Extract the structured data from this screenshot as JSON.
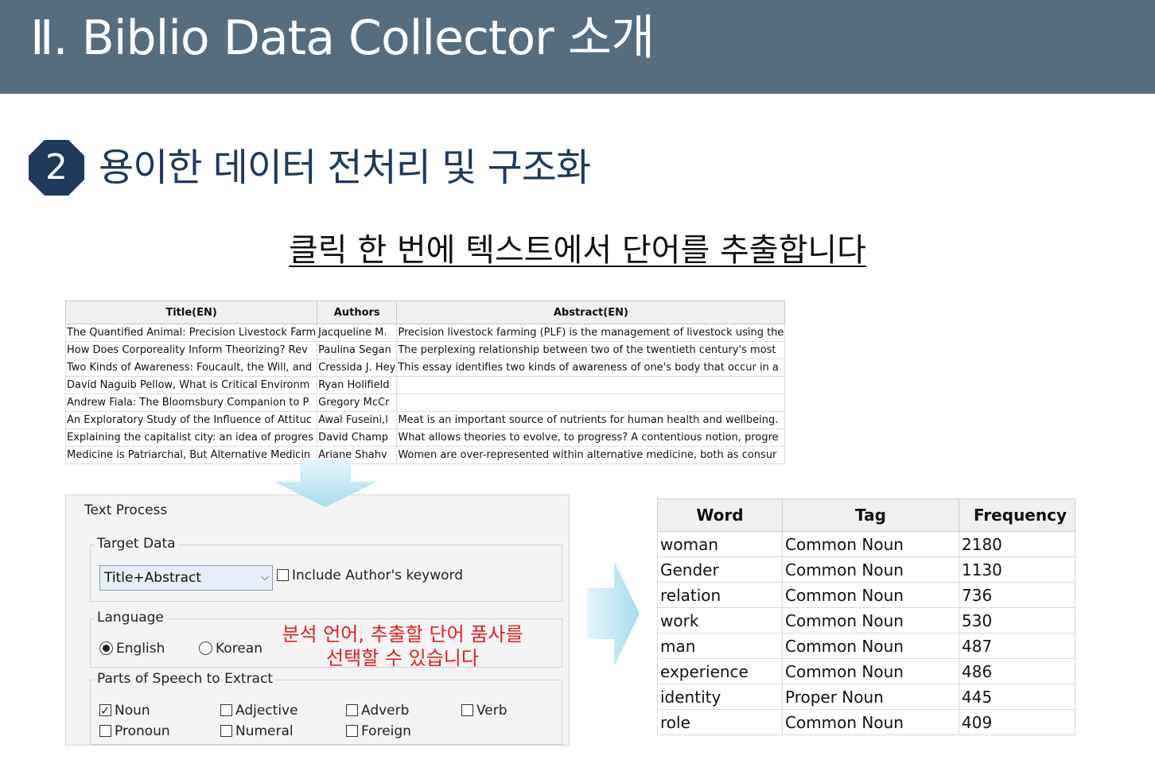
{
  "header": {
    "title": "Ⅱ.  Biblio Data Collector 소개"
  },
  "section": {
    "number": "2",
    "title": "용이한 데이터 전처리 및 구조화"
  },
  "subtitle": "클릭 한 번에 텍스트에서 단어를 추출합니다",
  "paper_table": {
    "columns": [
      "Title(EN)",
      "Authors",
      "Abstract(EN)"
    ],
    "rows": [
      [
        "The Quantified Animal: Precision Livestock Farm",
        "Jacqueline M.",
        "Precision livestock farming (PLF) is the management of livestock using the"
      ],
      [
        "How Does Corporeality Inform Theorizing? Rev",
        "Paulina Segan",
        "The perplexing relationship between two of the twentieth century's most"
      ],
      [
        "Two Kinds of Awareness: Foucault, the Will, and",
        "Cressida J. Hey",
        "This essay identifies two kinds of awareness of one's body that occur in a"
      ],
      [
        "David Naguib Pellow, What is Critical Environm",
        "Ryan Holifield",
        ""
      ],
      [
        "Andrew Fiala: The Bloomsbury Companion to P",
        "Gregory McCr",
        ""
      ],
      [
        "An Exploratory Study of the Influence of Attituc",
        "Awal Fuseini,l",
        "Meat is an important source of nutrients for human health and wellbeing."
      ],
      [
        "Explaining the capitalist city: an idea of progres",
        "David Champ",
        "What allows theories to evolve, to progress? A contentious notion, progre"
      ],
      [
        "Medicine is Patriarchal, But Alternative Medicin",
        "Ariane Shahv",
        "Women are over-represented within alternative medicine, both as consur"
      ]
    ]
  },
  "text_process": {
    "title": "Text Process",
    "target_data": {
      "label": "Target Data",
      "select_value": "Title+Abstract",
      "include_keyword_label": "Include Author's keyword",
      "include_keyword_checked": false
    },
    "language": {
      "label": "Language",
      "options": [
        {
          "label": "English",
          "selected": true
        },
        {
          "label": "Korean",
          "selected": false
        }
      ]
    },
    "note_line1": "분석 언어, 추출할 단어 품사를",
    "note_line2": "선택할 수 있습니다",
    "pos": {
      "label": "Parts of Speech to Extract",
      "options": [
        {
          "label": "Noun",
          "checked": true
        },
        {
          "label": "Adjective",
          "checked": false
        },
        {
          "label": "Adverb",
          "checked": false
        },
        {
          "label": "Verb",
          "checked": false
        },
        {
          "label": "Pronoun",
          "checked": false
        },
        {
          "label": "Numeral",
          "checked": false
        },
        {
          "label": "Foreign",
          "checked": false
        }
      ]
    }
  },
  "word_table": {
    "columns": [
      "Word",
      "Tag",
      "Frequency"
    ],
    "rows": [
      [
        "woman",
        "Common Noun",
        "2180"
      ],
      [
        "Gender",
        "Common Noun",
        "1130"
      ],
      [
        "relation",
        "Common Noun",
        "736"
      ],
      [
        "work",
        "Common Noun",
        "530"
      ],
      [
        "man",
        "Common Noun",
        "487"
      ],
      [
        "experience",
        "Common Noun",
        "486"
      ],
      [
        "identity",
        "Proper Noun",
        "445"
      ],
      [
        "role",
        "Common Noun",
        "409"
      ]
    ]
  },
  "colors": {
    "header_bg": "#566d80",
    "badge_bg": "#1f3a5a",
    "note": "#e02020",
    "arrow": "#b8e3f0"
  },
  "icons": {
    "dropdown": "chevron-down-icon",
    "flow_down": "arrow-down-icon",
    "flow_right": "arrow-right-icon"
  }
}
